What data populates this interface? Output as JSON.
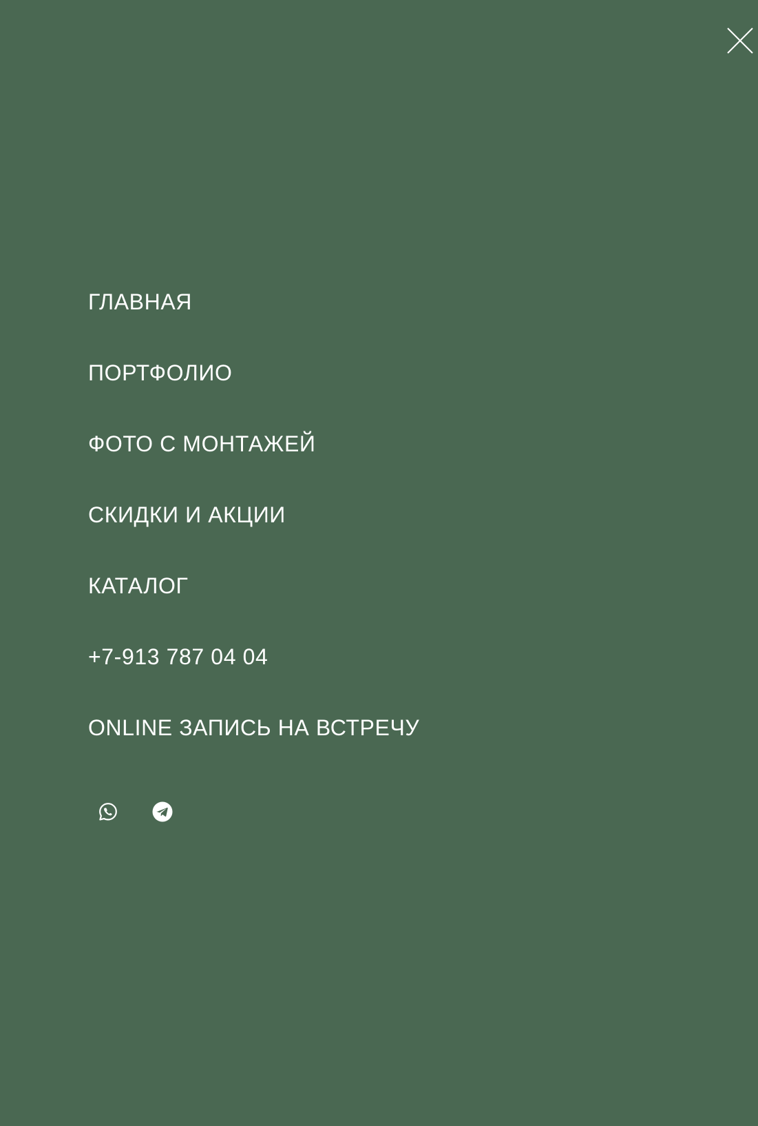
{
  "menu": {
    "items": [
      {
        "label": "ГЛАВНАЯ"
      },
      {
        "label": "ПОРТФОЛИО"
      },
      {
        "label": "ФОТО С МОНТАЖЕЙ"
      },
      {
        "label": "СКИДКИ И АКЦИИ"
      },
      {
        "label": "КАТАЛОГ"
      },
      {
        "label": "+7-913 787 04 04"
      },
      {
        "label": "ONLINE ЗАПИСЬ НА ВСТРЕЧУ"
      }
    ]
  },
  "social": {
    "icons": [
      "whatsapp-icon",
      "telegram-icon"
    ]
  },
  "close": {
    "icon": "close-icon"
  },
  "colors": {
    "background": "#4a6852",
    "text": "#ffffff"
  }
}
